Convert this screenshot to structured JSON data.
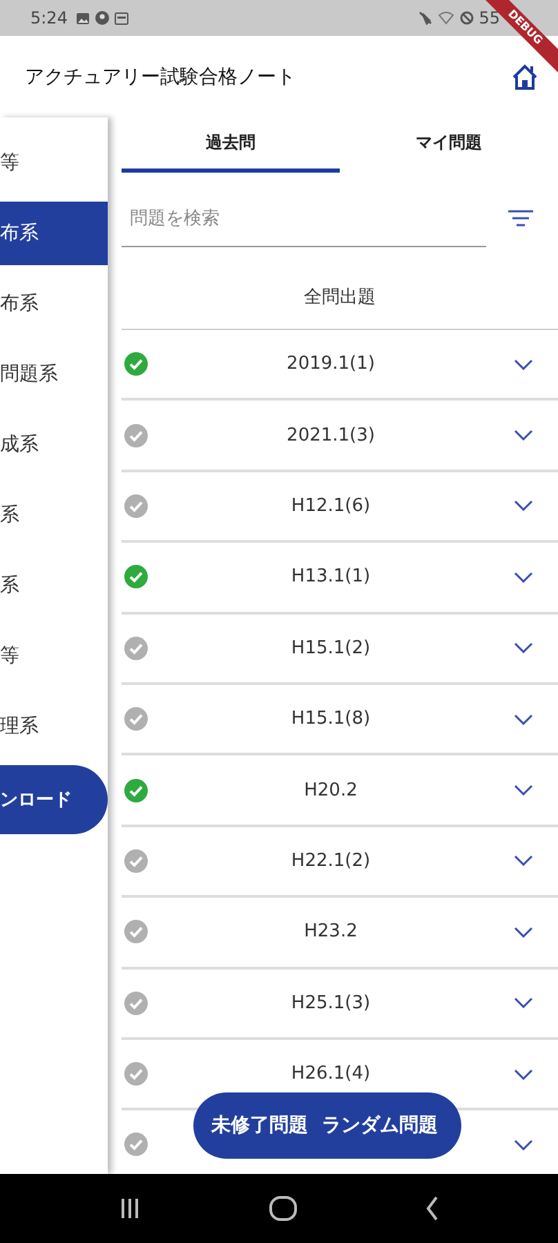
{
  "status_bar": {
    "time": "5:24",
    "battery": "55"
  },
  "debug_banner": "DEBUG",
  "app_bar": {
    "title": "アクチュアリー試験合格ノート"
  },
  "sidebar": {
    "items": [
      {
        "label": "等",
        "selected": false
      },
      {
        "label": "布系",
        "selected": true
      },
      {
        "label": "布系",
        "selected": false
      },
      {
        "label": "問題系",
        "selected": false
      },
      {
        "label": "成系",
        "selected": false
      },
      {
        "label": "系",
        "selected": false
      },
      {
        "label": "系",
        "selected": false
      },
      {
        "label": "等",
        "selected": false
      },
      {
        "label": "理系",
        "selected": false
      }
    ],
    "button": "ンロード"
  },
  "tabs": [
    {
      "label": "過去問",
      "selected": true
    },
    {
      "label": "マイ問題",
      "selected": false
    }
  ],
  "search": {
    "placeholder": "問題を検索"
  },
  "all_button": "全問出題",
  "rows": [
    {
      "label": "2019.1(1)",
      "done": true
    },
    {
      "label": "2021.1(3)",
      "done": false
    },
    {
      "label": "H12.1(6)",
      "done": false
    },
    {
      "label": "H13.1(1)",
      "done": true
    },
    {
      "label": "H15.1(2)",
      "done": false
    },
    {
      "label": "H15.1(8)",
      "done": false
    },
    {
      "label": "H20.2",
      "done": true
    },
    {
      "label": "H22.1(2)",
      "done": false
    },
    {
      "label": "H23.2",
      "done": false
    },
    {
      "label": "H25.1(3)",
      "done": false
    },
    {
      "label": "H26.1(4)",
      "done": false
    },
    {
      "done": false
    }
  ],
  "fab": [
    "未修了問題",
    "ランダム問題"
  ]
}
